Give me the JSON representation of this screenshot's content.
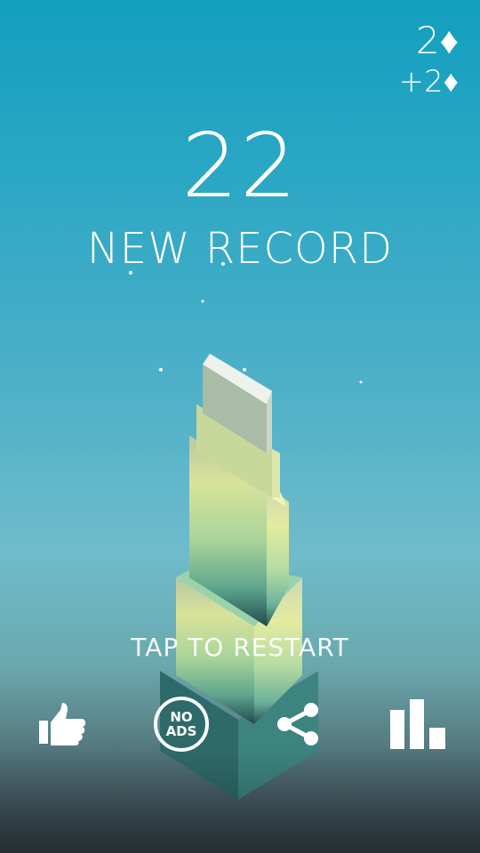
{
  "hud": {
    "gems_total": "2♦",
    "gems_earned": "+2♦"
  },
  "score": "22",
  "status": "NEW RECORD",
  "prompt": "TAP TO RESTART",
  "buttons": {
    "noads_line1": "NO",
    "noads_line2": "ADS",
    "like_icon": "thumbs-up-icon",
    "share_icon": "share-icon",
    "leaderboard_icon": "leaderboard-icon"
  },
  "colors": {
    "sky_top": "#129fbe",
    "tower_top": "#e8ecb0",
    "tower_base": "#2c6a6c"
  }
}
